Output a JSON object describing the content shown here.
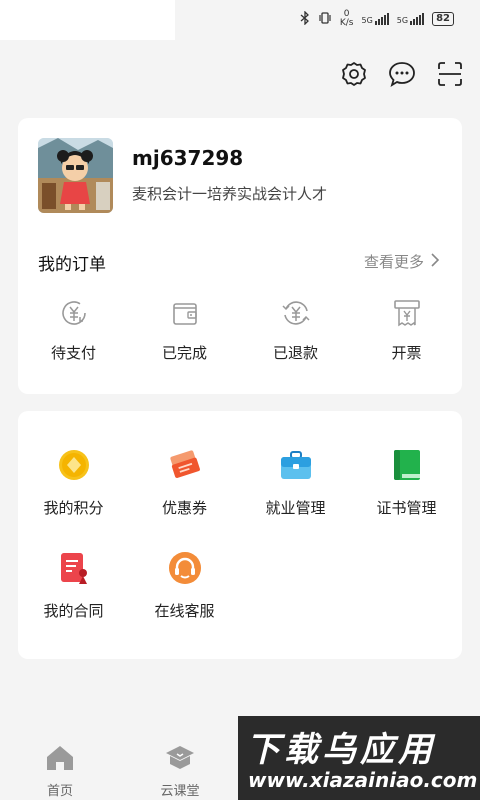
{
  "status_bar": {
    "speed_value": "0",
    "speed_unit": "K/s",
    "network_1": "5G",
    "network_2": "5G",
    "battery": "82"
  },
  "top_actions": {
    "settings_icon": "gear-icon",
    "message_icon": "chat-bubble-icon",
    "scan_icon": "scan-icon"
  },
  "profile": {
    "username": "mj637298",
    "bio": "麦积会计一培养实战会计人才"
  },
  "orders": {
    "title": "我的订单",
    "see_more": "查看更多",
    "items": [
      {
        "label": "待支付",
        "icon": "pending-payment-icon"
      },
      {
        "label": "已完成",
        "icon": "wallet-icon"
      },
      {
        "label": "已退款",
        "icon": "refund-icon"
      },
      {
        "label": "开票",
        "icon": "invoice-icon"
      }
    ]
  },
  "services": {
    "items": [
      {
        "label": "我的积分",
        "icon": "points-icon",
        "color": "#f5b400"
      },
      {
        "label": "优惠券",
        "icon": "coupon-icon",
        "color": "#f0562e"
      },
      {
        "label": "就业管理",
        "icon": "briefcase-icon",
        "color": "#2c9fe0"
      },
      {
        "label": "证书管理",
        "icon": "certificate-book-icon",
        "color": "#22b24c"
      },
      {
        "label": "我的合同",
        "icon": "contract-icon",
        "color": "#e8343c"
      },
      {
        "label": "在线客服",
        "icon": "customer-service-icon",
        "color": "#f07828"
      }
    ]
  },
  "bottom_nav": {
    "items": [
      {
        "label": "首页",
        "icon": "home-icon"
      },
      {
        "label": "云课堂",
        "icon": "cloud-class-icon"
      }
    ]
  },
  "watermark": {
    "main": "下载乌应用",
    "url": "www.xiazainiao.com"
  }
}
